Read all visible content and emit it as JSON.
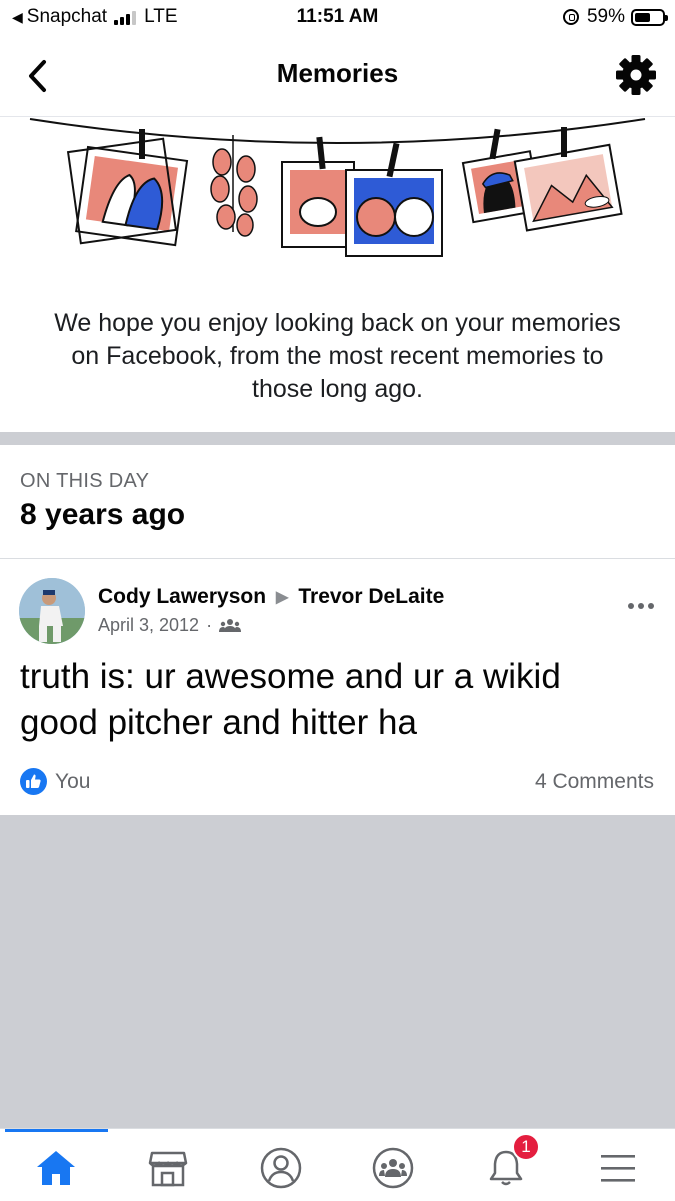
{
  "status_bar": {
    "back_app": "Snapchat",
    "network": "LTE",
    "time": "11:51 AM",
    "battery": "59%",
    "battery_level": 0.59
  },
  "header": {
    "title": "Memories"
  },
  "hero": {
    "message": "We hope you enjoy looking back on your memories on Facebook, from the most recent memories to those long ago."
  },
  "on_this_day": {
    "label": "ON THIS DAY",
    "years_ago": "8 years ago"
  },
  "post": {
    "author": "Cody Laweryson",
    "recipient": "Trevor DeLaite",
    "date": "April 3, 2012",
    "separator": "·",
    "audience_icon": "friends-icon",
    "text": "truth is: ur awesome and ur a wikid good pitcher and hitter ha",
    "reaction_label": "You",
    "comments_label": "4 Comments"
  },
  "tab_bar": {
    "tabs": [
      "home",
      "marketplace",
      "profile",
      "groups",
      "notifications",
      "menu"
    ],
    "active": "home",
    "notifications_count": "1"
  },
  "colors": {
    "accent": "#1877f2",
    "badge": "#e41e3f",
    "divider_gray": "#ccced3",
    "secondary_text": "#65676b"
  }
}
